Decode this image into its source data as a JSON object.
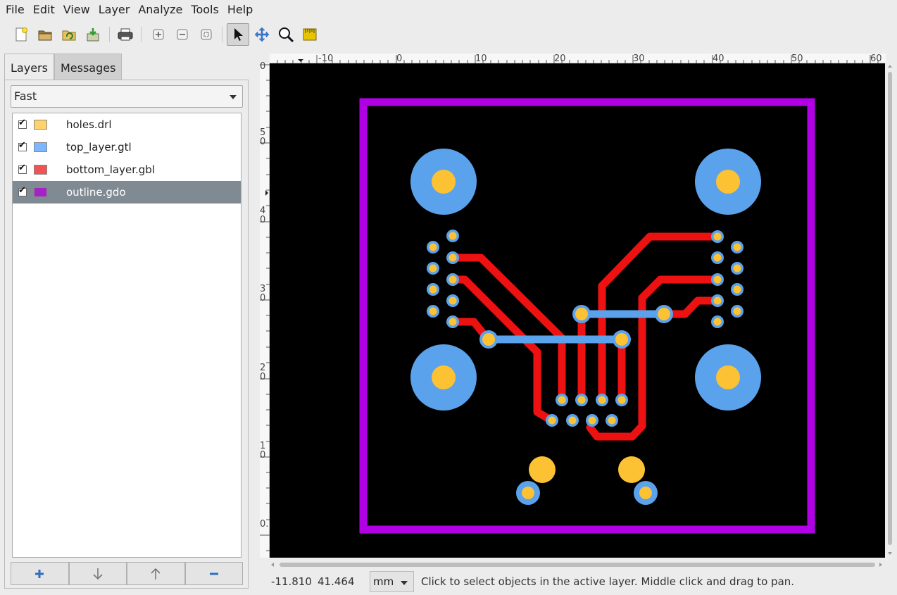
{
  "menu": [
    "File",
    "Edit",
    "View",
    "Layer",
    "Analyze",
    "Tools",
    "Help"
  ],
  "toolbar": {
    "icons": [
      "new-project-icon",
      "open-project-icon",
      "revert-icon",
      "save-icon",
      "print-icon",
      "zoom-in-icon",
      "zoom-out-icon",
      "zoom-fit-icon",
      "pointer-icon",
      "pan-icon",
      "zoom-tool-icon",
      "measure-tool-icon"
    ]
  },
  "tabs": [
    "Layers",
    "Messages"
  ],
  "render_mode": "Fast",
  "layers": [
    {
      "name": "holes.drl",
      "color": "#ffd36a",
      "checked": true,
      "selected": false
    },
    {
      "name": "top_layer.gtl",
      "color": "#7db7ff",
      "checked": true,
      "selected": false
    },
    {
      "name": "bottom_layer.gbl",
      "color": "#f05353",
      "checked": true,
      "selected": false
    },
    {
      "name": "outline.gdo",
      "color": "#a522c8",
      "checked": true,
      "selected": true
    }
  ],
  "layer_buttons": {
    "add": "+",
    "down": "↓",
    "up": "↑",
    "remove": "−"
  },
  "ruler": {
    "h_labels": [
      "-10",
      "0",
      "10",
      "20",
      "30",
      "40",
      "50",
      "60"
    ],
    "v_labels": [
      "0",
      "5\n0",
      "4\n0",
      "3\n0",
      "2\n0",
      "1\n0",
      "0."
    ]
  },
  "colors": {
    "outline": "#b100e6",
    "top_copper": "#5aa2eb",
    "bottom_copper": "#ee1111",
    "drill": "#fcc234",
    "background": "#000000"
  },
  "status": {
    "x": "-11.810",
    "y": "41.464",
    "unit": "mm",
    "message": "Click to select objects in the active layer. Middle click and drag to pan."
  }
}
